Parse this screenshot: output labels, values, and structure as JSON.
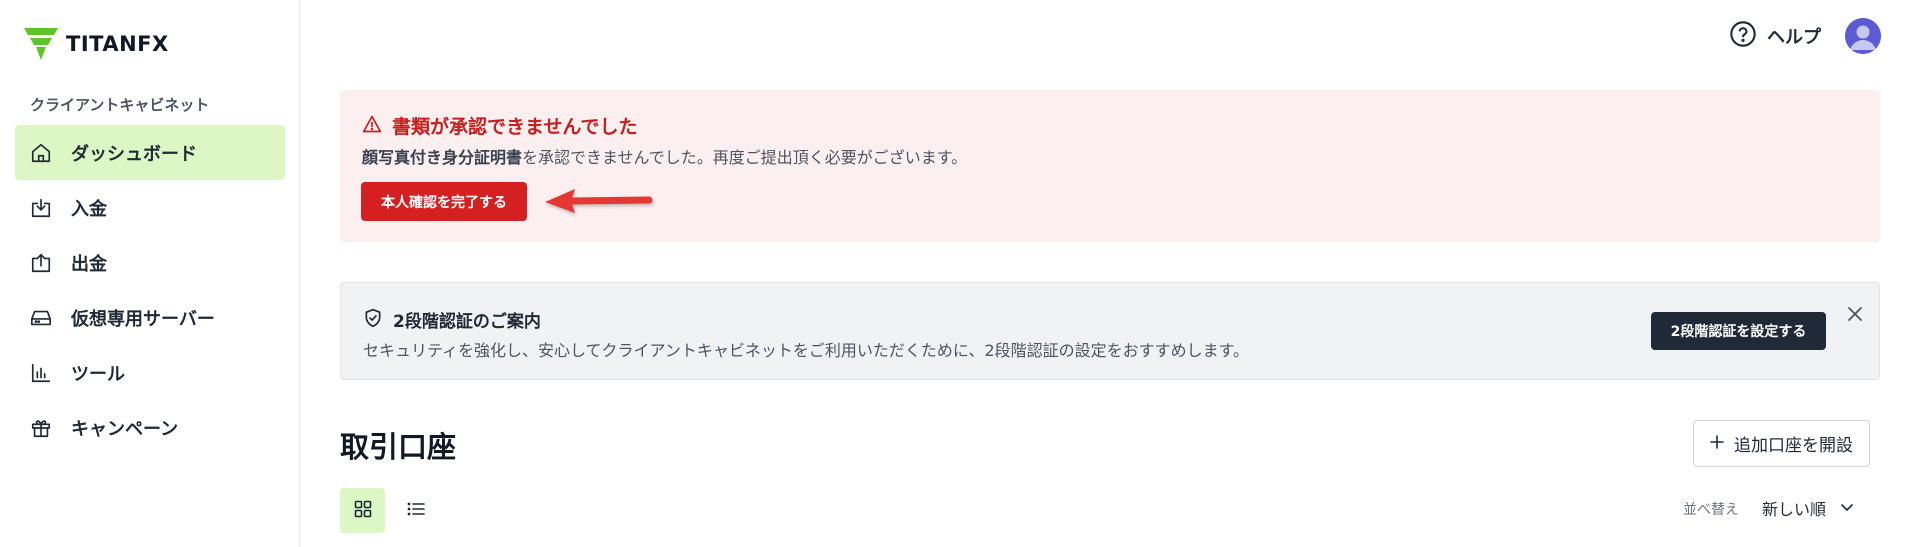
{
  "brand": {
    "logo_text": "TITANFX",
    "accent": "#5ec427"
  },
  "sidebar": {
    "heading": "クライアントキャビネット",
    "items": [
      {
        "label": "ダッシュボード",
        "icon": "home-icon",
        "active": true
      },
      {
        "label": "入金",
        "icon": "deposit-icon",
        "active": false
      },
      {
        "label": "出金",
        "icon": "withdraw-icon",
        "active": false
      },
      {
        "label": "仮想専用サーバー",
        "icon": "server-icon",
        "active": false
      },
      {
        "label": "ツール",
        "icon": "chart-icon",
        "active": false
      },
      {
        "label": "キャンペーン",
        "icon": "gift-icon",
        "active": false
      }
    ]
  },
  "header": {
    "help_label": "ヘルプ",
    "help_icon": "question-circle-icon",
    "avatar_icon": "user-avatar-icon"
  },
  "alert_document": {
    "title": "書類が承認できませんでした",
    "body_strong": "顔写真付き身分証明書",
    "body_rest": "を承認できませんでした。再度ご提出頂く必要がございます。",
    "button_label": "本人確認を完了する",
    "icon": "warning-triangle-icon",
    "color": "#d42020"
  },
  "alert_2fa": {
    "title": "2段階認証のご案内",
    "body": "セキュリティを強化し、安心してクライアントキャビネットをご利用いただくために、2段階認証の設定をおすすめします。",
    "button_label": "2段階認証を設定する",
    "icon": "shield-check-icon",
    "close_icon": "close-icon"
  },
  "accounts": {
    "title": "取引口座",
    "add_button_label": "追加口座を開設",
    "sort_label": "並べ替え",
    "sort_value": "新しい順"
  }
}
